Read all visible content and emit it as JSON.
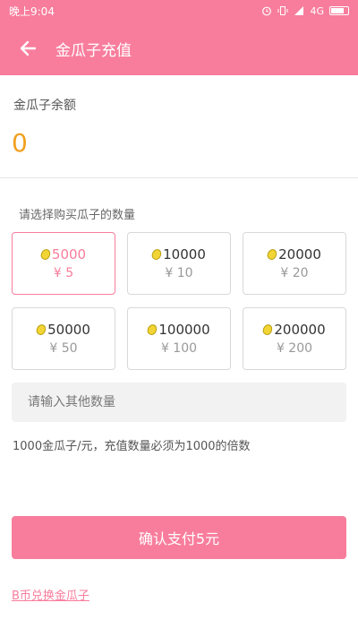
{
  "status_bar": {
    "time": "晚上9:04",
    "network": "4G",
    "icons": [
      "alarm-icon",
      "vibrate-icon",
      "signal-icon",
      "battery-icon"
    ]
  },
  "header": {
    "back_icon": "arrow-left-icon",
    "title": "金瓜子充值"
  },
  "balance": {
    "label": "金瓜子余额",
    "value": "0"
  },
  "packages": {
    "label": "请选择购买瓜子的数量",
    "selected_index": 0,
    "items": [
      {
        "amount": "5000",
        "price": "¥ 5"
      },
      {
        "amount": "10000",
        "price": "¥ 10"
      },
      {
        "amount": "20000",
        "price": "¥ 20"
      },
      {
        "amount": "50000",
        "price": "¥ 50"
      },
      {
        "amount": "100000",
        "price": "¥ 100"
      },
      {
        "amount": "200000",
        "price": "¥ 200"
      }
    ]
  },
  "custom_amount": {
    "placeholder": "请输入其他数量",
    "value": ""
  },
  "note": "1000金瓜子/元，充值数量必须为1000的倍数",
  "pay_button": {
    "label": "确认支付5元"
  },
  "exchange_link": "B币兑换金瓜子",
  "colors": {
    "accent": "#f87d9c",
    "balance": "#f0a020",
    "seed": "#f2d535"
  }
}
